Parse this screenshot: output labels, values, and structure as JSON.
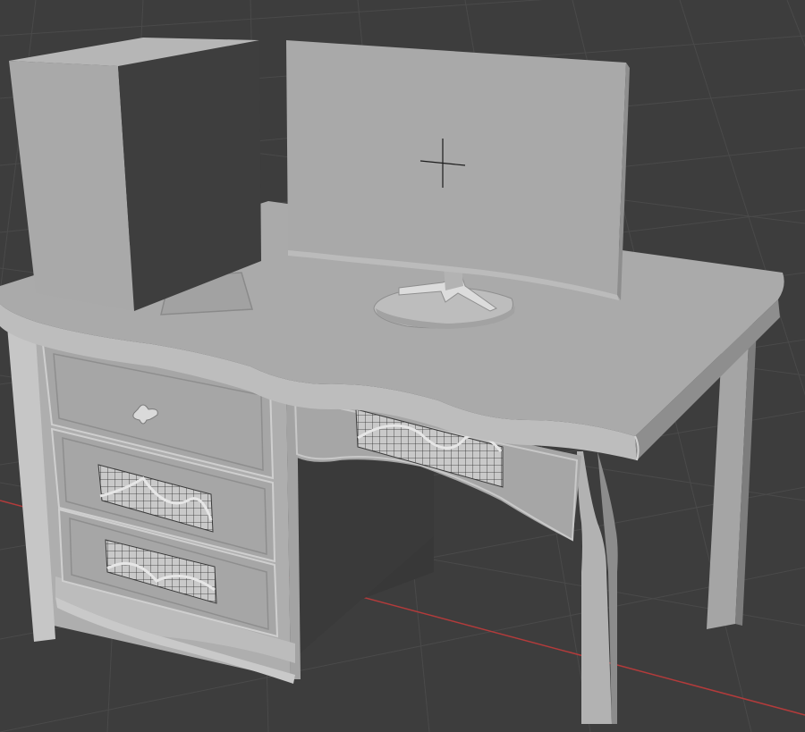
{
  "viewport": {
    "shading_mode": "solid",
    "background_color": "#3d3d3d",
    "grid_line_color": "#4a4a4a",
    "x_axis_color": "#b33b3b",
    "object_color": "#9d9d9d",
    "cursor": "3d-cursor"
  },
  "scene": {
    "objects": [
      {
        "name": "computer-case",
        "icon": "box-object"
      },
      {
        "name": "monitor",
        "icon": "monitor-object"
      },
      {
        "name": "desk",
        "icon": "desk-object"
      },
      {
        "name": "drawer-handle",
        "icon": "handle-object"
      },
      {
        "name": "paper-sheet",
        "icon": "plane-object"
      }
    ]
  }
}
